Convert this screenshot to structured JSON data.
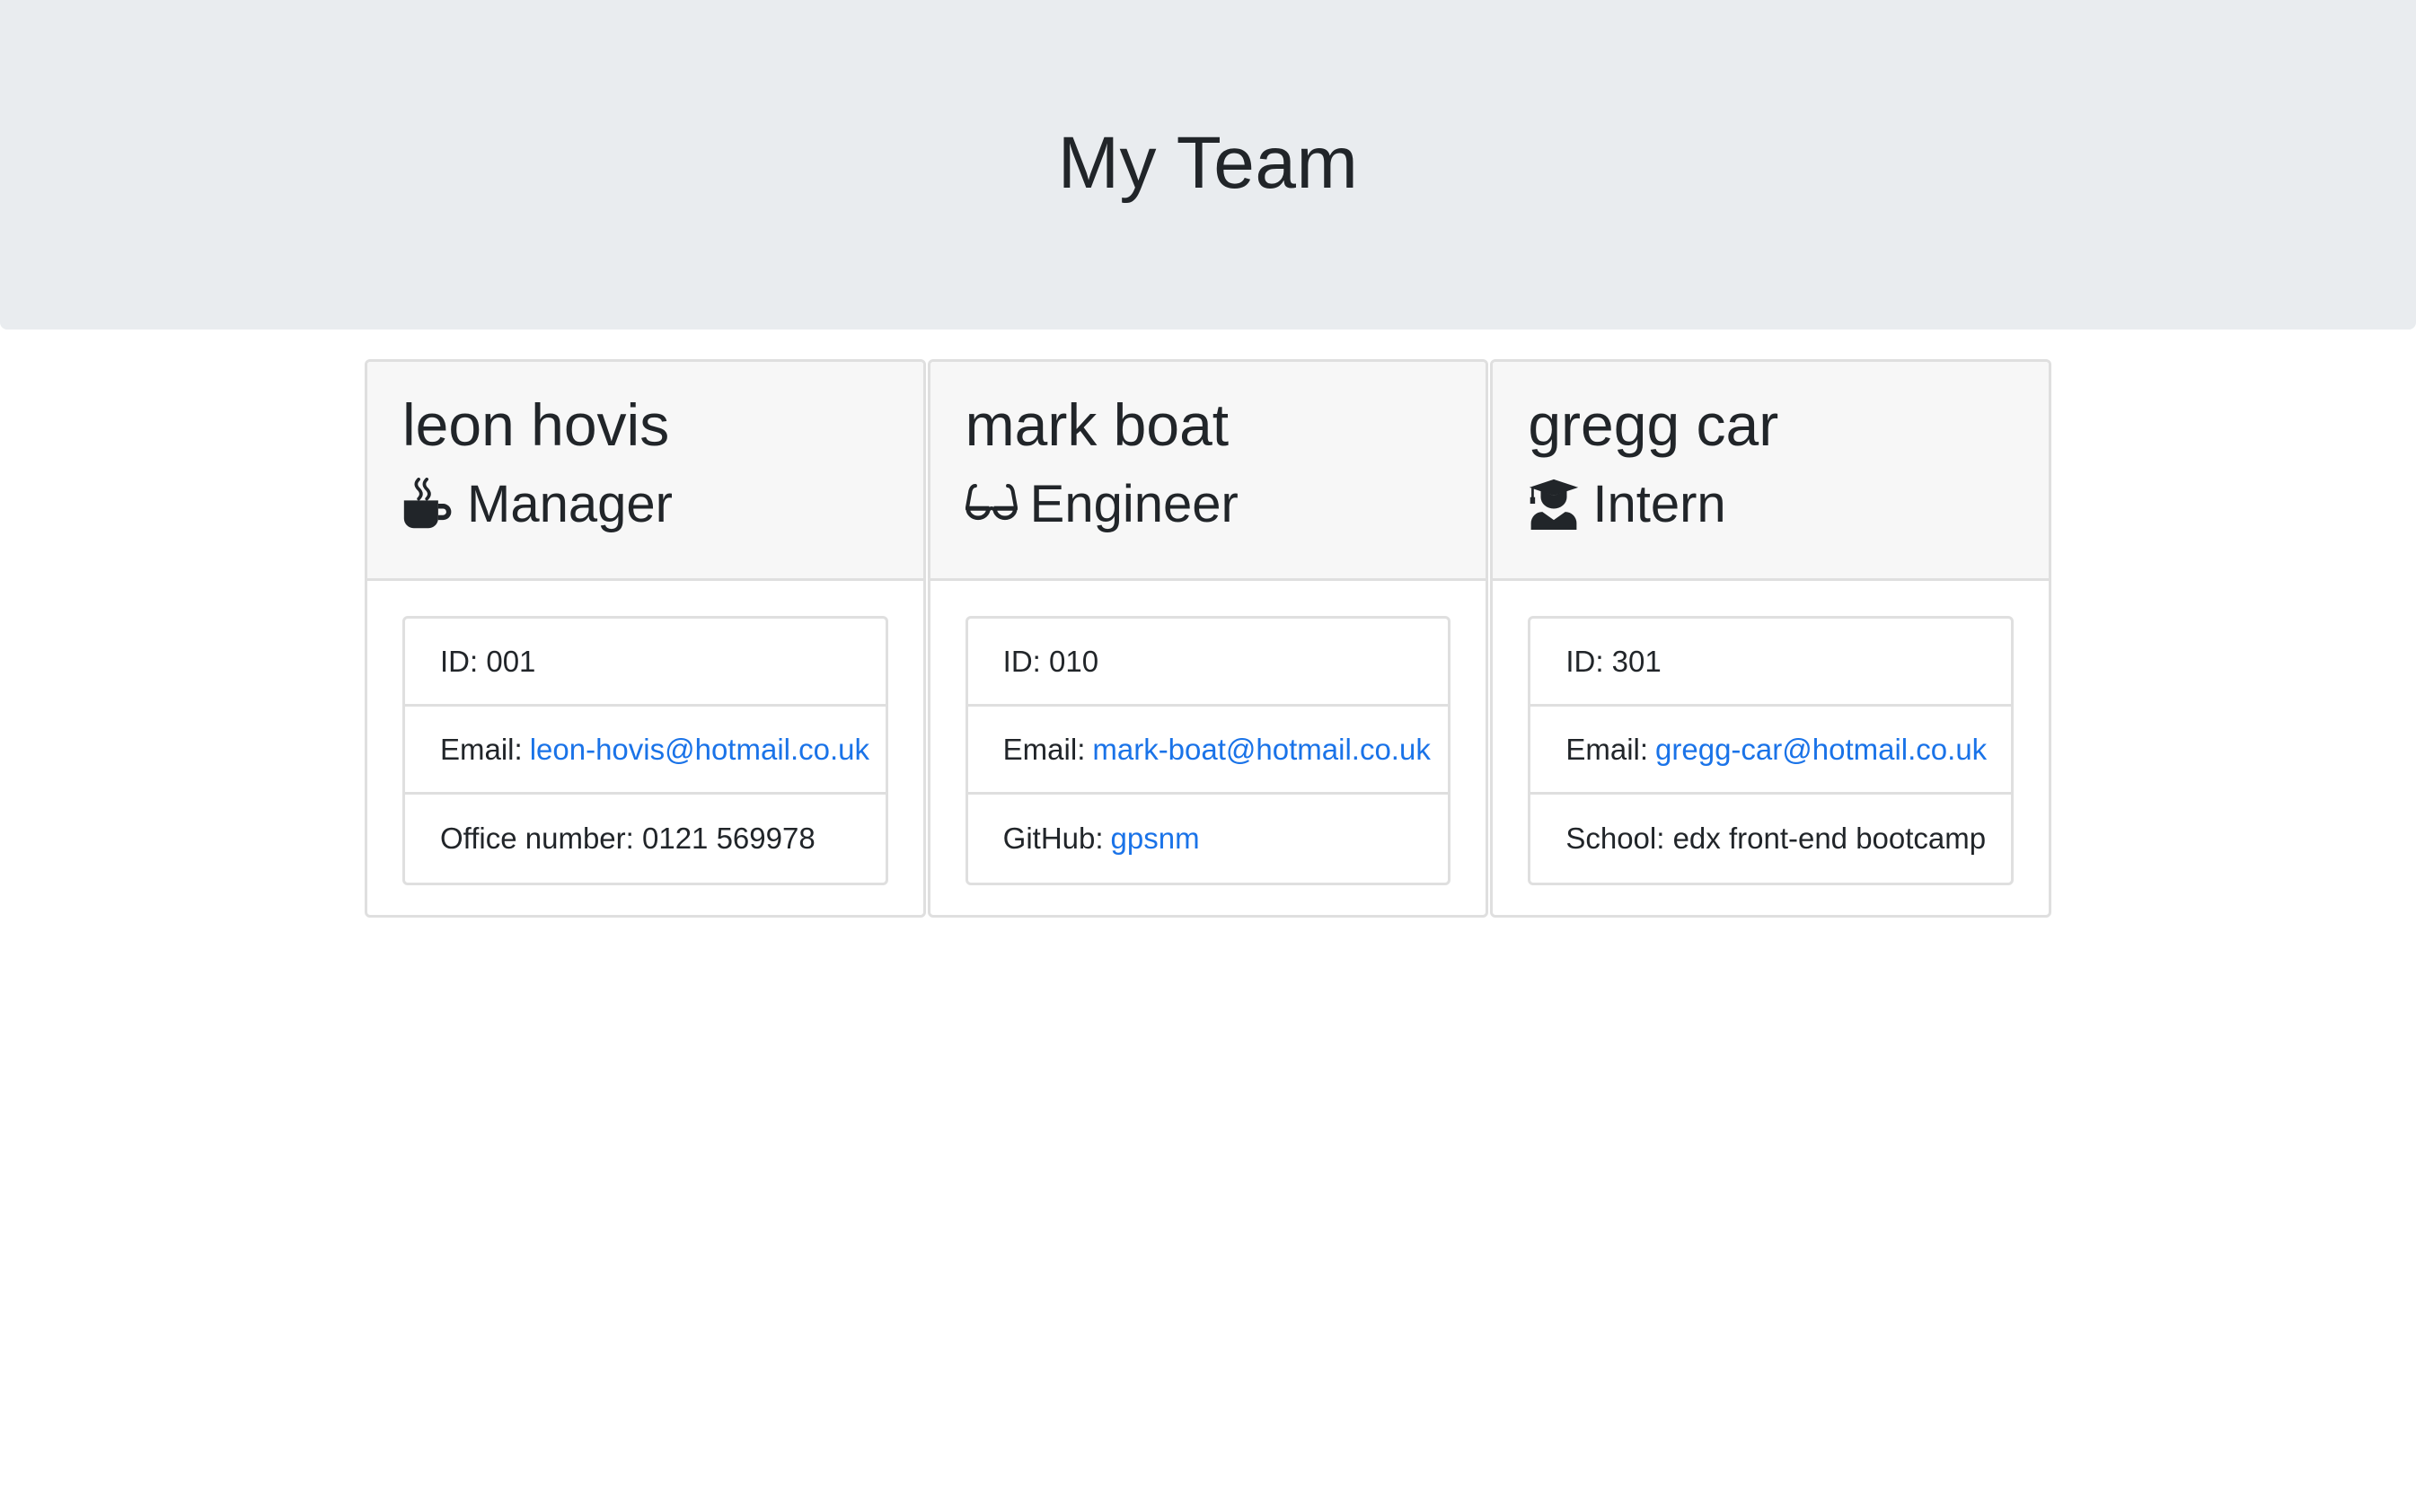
{
  "header": {
    "title": "My Team"
  },
  "team": [
    {
      "name": "leon hovis",
      "role": "Manager",
      "role_icon": "mug-icon",
      "id_text": "ID: 001",
      "email_label": "Email:",
      "email": "leon-hovis@hotmail.co.uk",
      "extra_label": "Office number: 0121 569978",
      "extra_link": ""
    },
    {
      "name": "mark boat",
      "role": "Engineer",
      "role_icon": "glasses-icon",
      "id_text": "ID: 010",
      "email_label": "Email:",
      "email": "mark-boat@hotmail.co.uk",
      "extra_label": "GitHub:",
      "extra_link": "gpsnm"
    },
    {
      "name": "gregg car",
      "role": "Intern",
      "role_icon": "graduate-icon",
      "id_text": "ID: 301",
      "email_label": "Email:",
      "email": "gregg-car@hotmail.co.uk",
      "extra_label": "School: edx front-end bootcamp",
      "extra_link": ""
    }
  ],
  "colors": {
    "jumbotron_bg": "#e9ecef",
    "card_header_bg": "#f7f7f7",
    "link": "#1a73e8",
    "text": "#212529"
  }
}
